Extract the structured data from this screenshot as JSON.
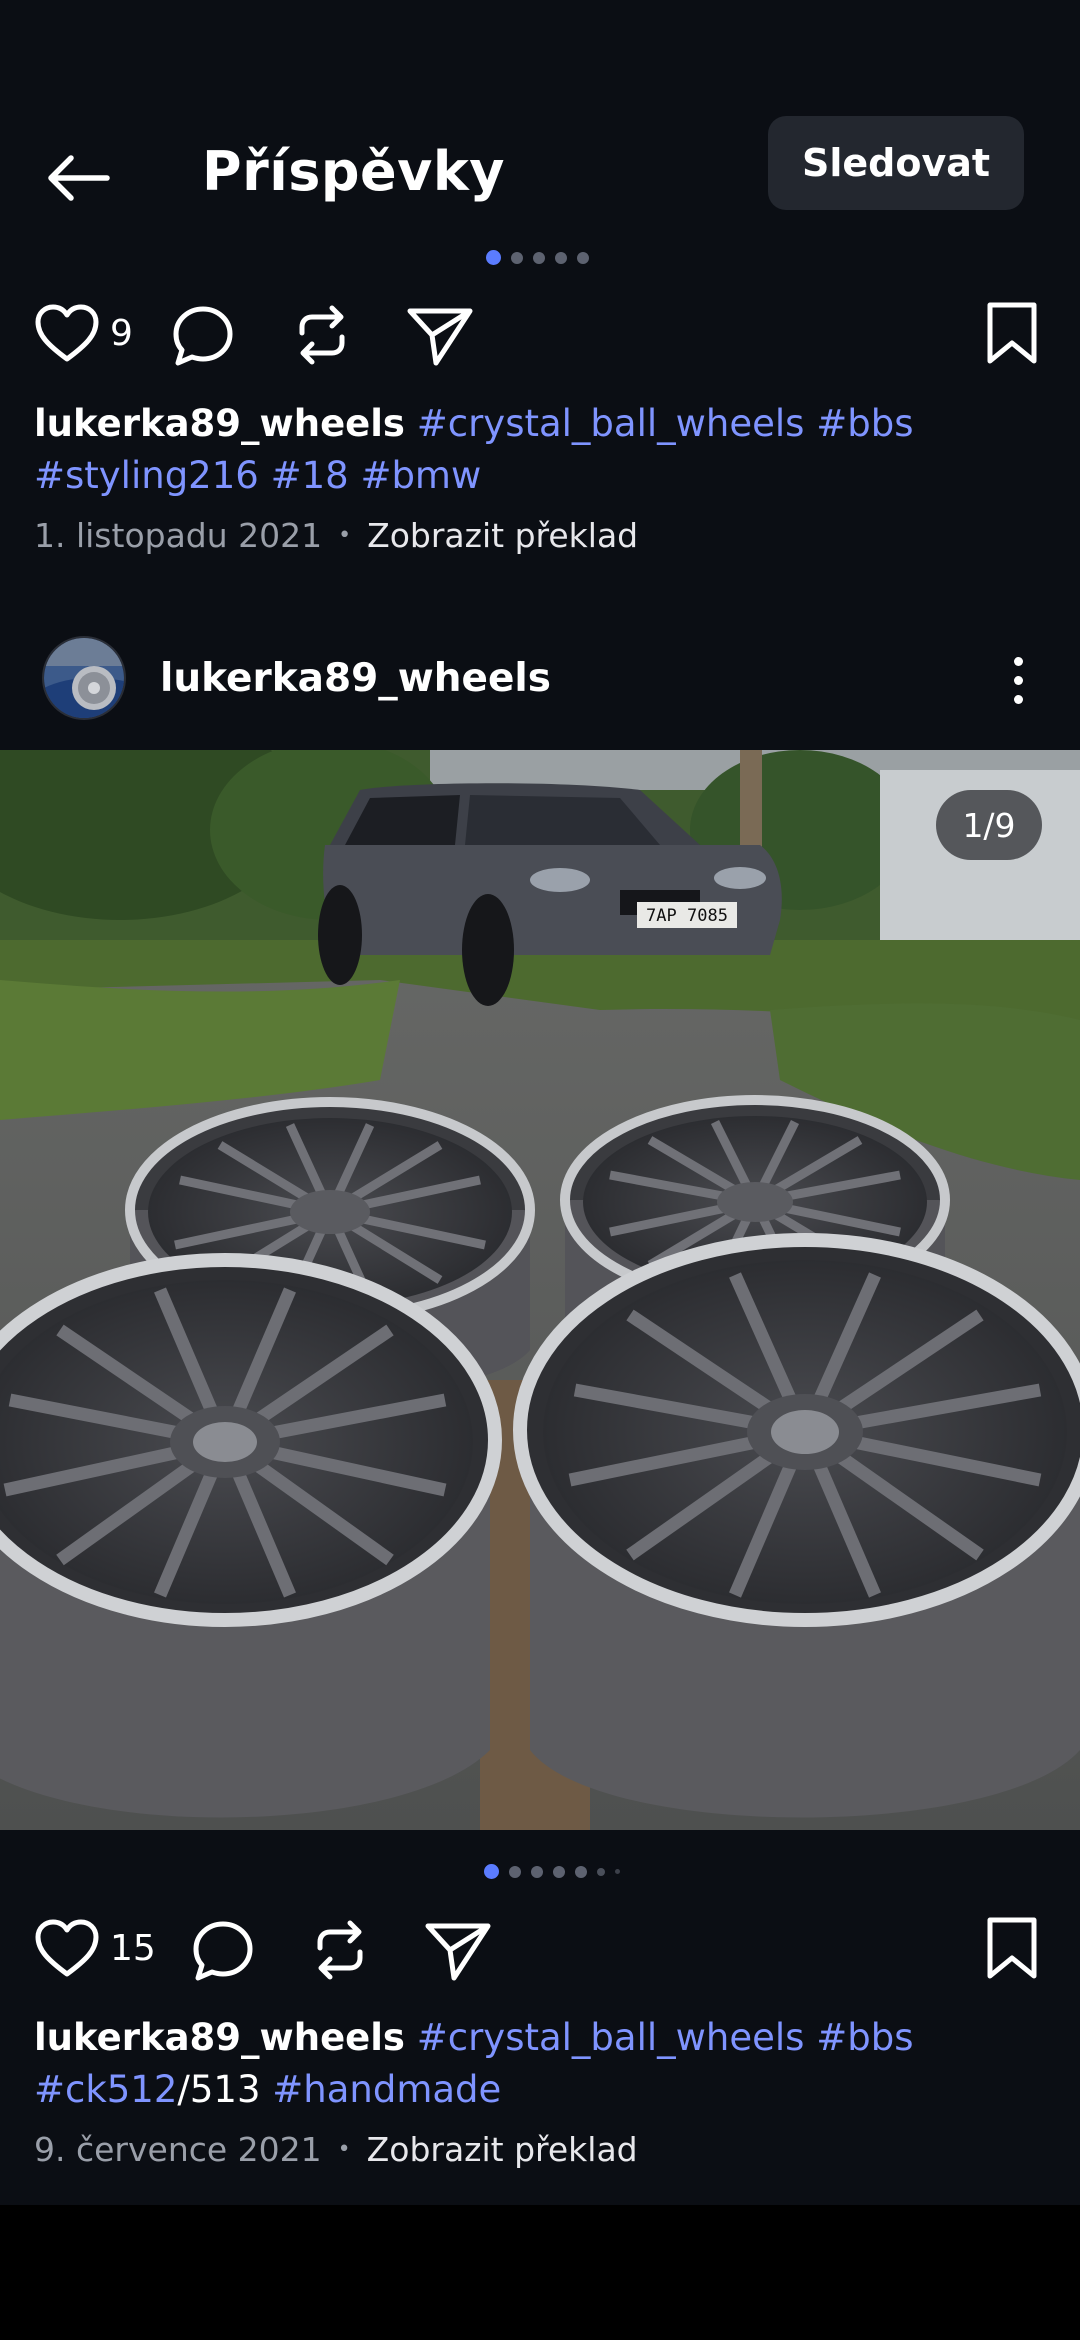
{
  "header": {
    "title": "Příspěvky",
    "follow_label": "Sledovat"
  },
  "post1": {
    "likes": "9",
    "username": "lukerka89_wheels",
    "tags_line1": [
      "#crystal_ball_wheels",
      "#bbs"
    ],
    "tags_line2": [
      "#styling216",
      "#18",
      "#bmw"
    ],
    "date": "1. listopadu 2021",
    "separator": "•",
    "translate_label": "Zobrazit překlad",
    "carousel_dots": 5,
    "carousel_active": 1
  },
  "post2": {
    "username": "lukerka89_wheels",
    "image_counter": "1/9",
    "plate_text": "7AP 7085",
    "likes": "15",
    "caption_user": "lukerka89_wheels",
    "tags_line1": [
      "#crystal_ball_wheels",
      "#bbs"
    ],
    "line2_tag_a": "#ck512",
    "line2_plain": "/513",
    "line2_tag_b": "#handmade",
    "date": "9. července 2021",
    "separator": "•",
    "translate_label": "Zobrazit překlad",
    "carousel_dots": 7,
    "carousel_active": 1
  },
  "colors": {
    "background": "#0b0e14",
    "accent": "#5b7cff",
    "hashtag": "#7f94ff",
    "follow_button": "#23272f"
  },
  "icons": [
    "back-arrow-icon",
    "heart-icon",
    "comment-icon",
    "repost-icon",
    "send-icon",
    "bookmark-icon",
    "more-vertical-icon"
  ]
}
